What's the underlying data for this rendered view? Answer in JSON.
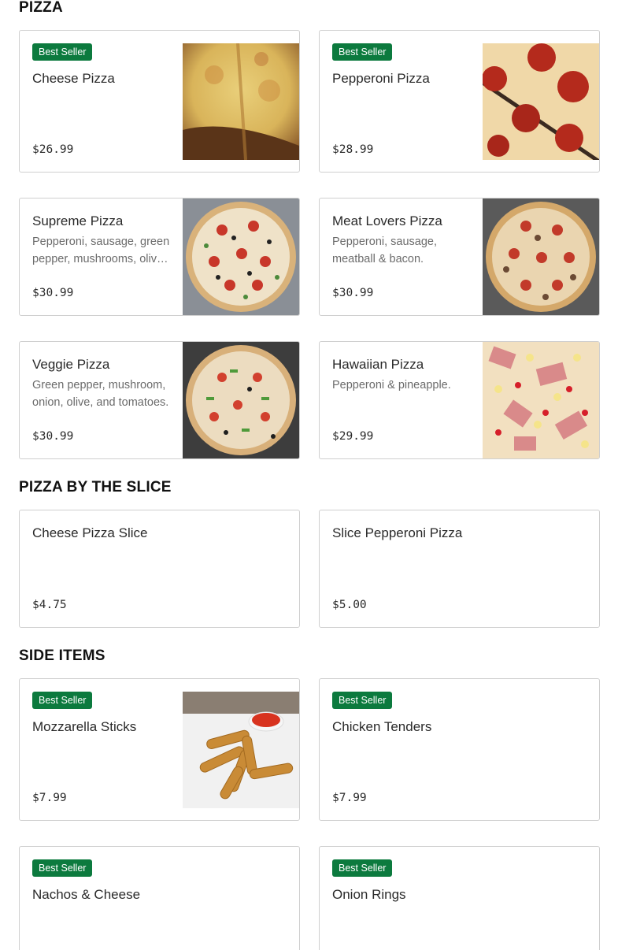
{
  "sections": {
    "pizza": "PIZZA",
    "slice": "PIZZA BY THE SLICE",
    "sides": "SIDE ITEMS"
  },
  "badge": "Best Seller",
  "items": {
    "cheese_pizza": {
      "title": "Cheese Pizza",
      "price": "$26.99",
      "best_seller": true
    },
    "pepperoni_pizza": {
      "title": "Pepperoni Pizza",
      "price": "$28.99",
      "best_seller": true
    },
    "supreme_pizza": {
      "title": "Supreme Pizza",
      "desc": "Pepperoni, sausage, green pepper, mushrooms, oliv…",
      "price": "$30.99"
    },
    "meat_lovers_pizza": {
      "title": "Meat Lovers Pizza",
      "desc": "Pepperoni, sausage, meatball & bacon.",
      "price": "$30.99"
    },
    "veggie_pizza": {
      "title": "Veggie Pizza",
      "desc": "Green pepper, mushroom, onion, olive, and tomatoes.",
      "price": "$30.99"
    },
    "hawaiian_pizza": {
      "title": "Hawaiian Pizza",
      "desc": "Pepperoni & pineapple.",
      "price": "$29.99"
    },
    "cheese_slice": {
      "title": "Cheese Pizza Slice",
      "price": "$4.75"
    },
    "pepperoni_slice": {
      "title": "Slice Pepperoni Pizza",
      "price": "$5.00"
    },
    "mozzarella_sticks": {
      "title": "Mozzarella Sticks",
      "price": "$7.99",
      "best_seller": true
    },
    "chicken_tenders": {
      "title": "Chicken Tenders",
      "price": "$7.99",
      "best_seller": true
    },
    "nachos_cheese": {
      "title": "Nachos & Cheese",
      "best_seller": true
    },
    "onion_rings": {
      "title": "Onion Rings",
      "best_seller": true
    }
  },
  "colors": {
    "badge": "#0c7a3e",
    "border": "#cfcfcf"
  }
}
